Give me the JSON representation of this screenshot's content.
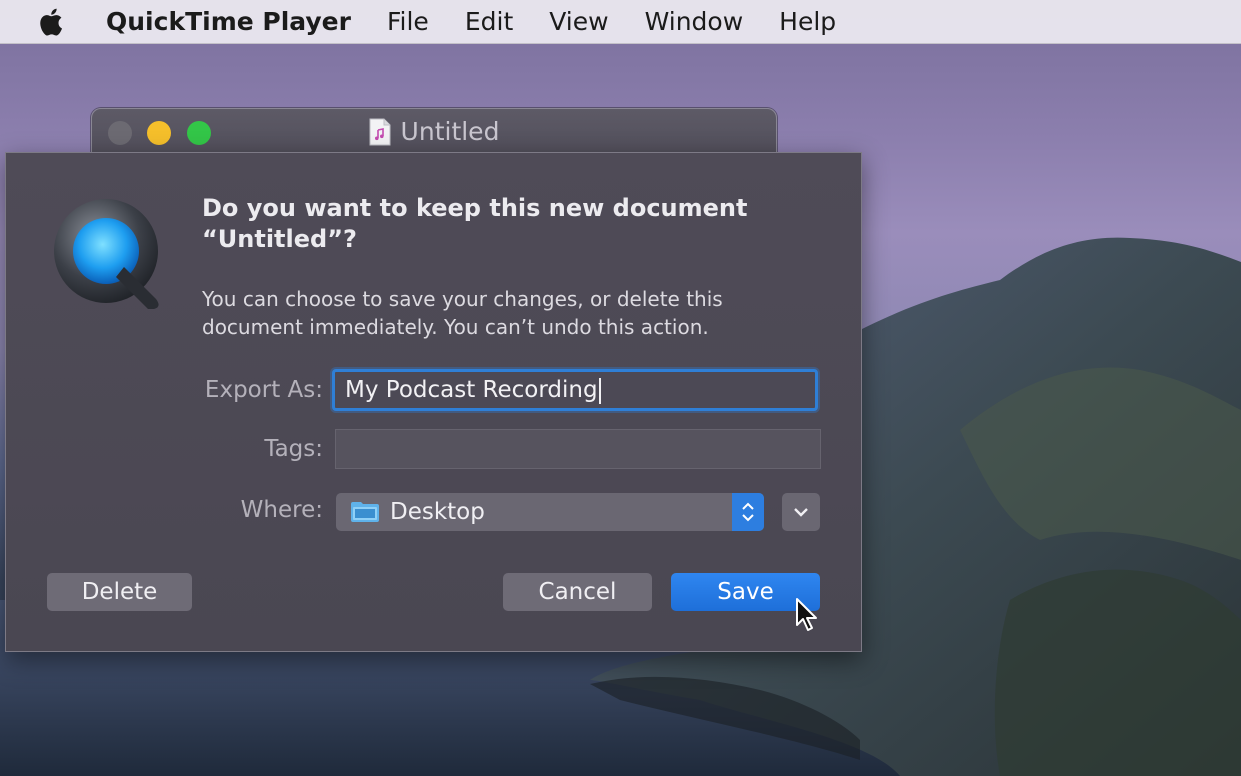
{
  "menubar": {
    "app_name": "QuickTime Player",
    "items": [
      "File",
      "Edit",
      "View",
      "Window",
      "Help"
    ]
  },
  "document_window": {
    "title": "Untitled"
  },
  "dialog": {
    "title": "Do you want to keep this new document “Untitled”?",
    "message": "You can choose to save your changes, or delete this document immediately. You can’t undo this action.",
    "export_as_label": "Export As:",
    "export_as_value": "My Podcast Recording",
    "tags_label": "Tags:",
    "tags_value": "",
    "where_label": "Where:",
    "where_value": "Desktop",
    "delete_label": "Delete",
    "cancel_label": "Cancel",
    "save_label": "Save"
  },
  "colors": {
    "accent": "#2f7fd6",
    "save_button": "#1e6fd9",
    "traffic_close": "#6c6a72",
    "traffic_minimize": "#f5bf2b",
    "traffic_maximize": "#33c648"
  },
  "icons": {
    "menubar": "apple-icon",
    "document": "audio-document-icon",
    "app": "quicktime-logo",
    "where": "folder-icon",
    "stepper": "up-down-chevron-icon",
    "expand": "chevron-down-icon",
    "pointer": "cursor-arrow-icon"
  }
}
